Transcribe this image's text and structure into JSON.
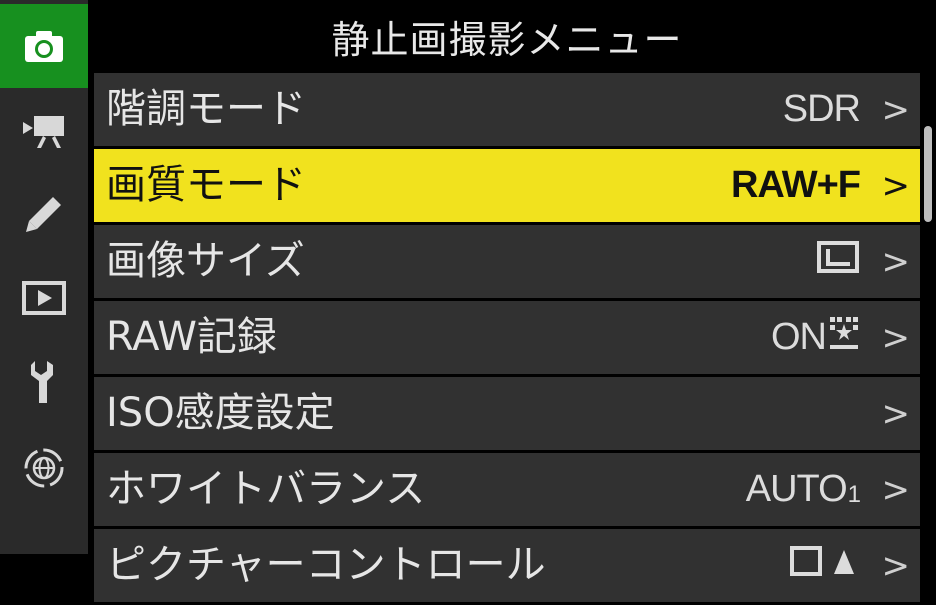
{
  "title": "静止画撮影メニュー",
  "tabs": [
    {
      "icon": "camera-icon",
      "active": true
    },
    {
      "icon": "movie-camera-icon",
      "active": false
    },
    {
      "icon": "pencil-icon",
      "active": false
    },
    {
      "icon": "playback-icon",
      "active": false
    },
    {
      "icon": "wrench-icon",
      "active": false
    },
    {
      "icon": "network-globe-icon",
      "active": false
    }
  ],
  "menu": {
    "items": [
      {
        "label": "階調モード",
        "value": "SDR",
        "chevron": ">"
      },
      {
        "label": "画質モード",
        "value": "RAW+F",
        "chevron": ">"
      },
      {
        "label": "画像サイズ",
        "value_icon": "image-size-large-icon",
        "chevron": ">"
      },
      {
        "label": "RAW記録",
        "value": "ON",
        "value_icon": "raw-compression-icon",
        "chevron": ">"
      },
      {
        "label": "ISO感度設定",
        "chevron": ">"
      },
      {
        "label": "ホワイトバランス",
        "value": "AUTO",
        "value_sub": "1",
        "chevron": ">"
      },
      {
        "label": "ピクチャーコントロール",
        "value_icon": "picture-control-icon",
        "chevron": ">"
      }
    ],
    "selected_index": 1
  },
  "colors": {
    "active_tab": "#17901f",
    "selected_row": "#f1e21e",
    "row_bg": "#313131",
    "sidebar_bg": "#2a2a2a"
  }
}
